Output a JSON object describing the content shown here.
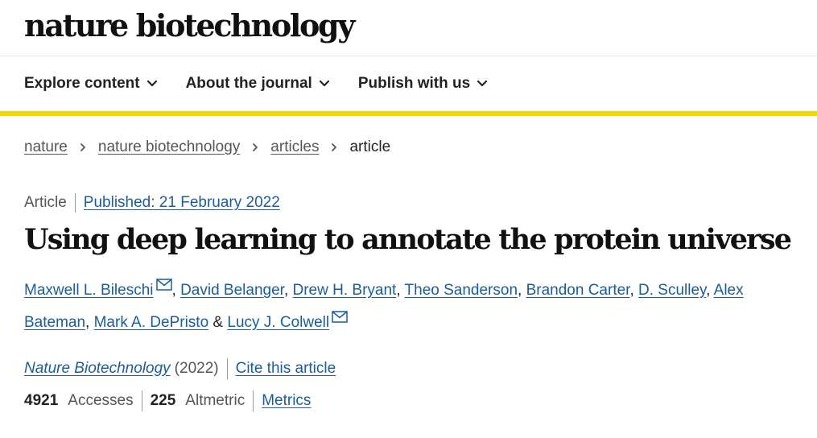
{
  "masthead": {
    "logo_text": "nature biotechnology"
  },
  "nav": {
    "items": [
      {
        "label": "Explore content",
        "icon": "chevron-down-icon"
      },
      {
        "label": "About the journal",
        "icon": "chevron-down-icon"
      },
      {
        "label": "Publish with us",
        "icon": "chevron-down-icon"
      }
    ],
    "accent_color": "#f2d700"
  },
  "breadcrumb": {
    "items": [
      "nature",
      "nature biotechnology",
      "articles"
    ],
    "current": "article",
    "separator_icon": "chevron-right-icon"
  },
  "article": {
    "type": "Article",
    "published": "Published: 21 February 2022",
    "title": "Using deep learning to annotate the protein universe",
    "authors": [
      {
        "name": "Maxwell L. Bileschi",
        "sep": "",
        "email_icon": "mail-icon"
      },
      {
        "name": "David Belanger",
        "sep": ", "
      },
      {
        "name": "Drew H. Bryant",
        "sep": ", "
      },
      {
        "name": "Theo Sanderson",
        "sep": ", "
      },
      {
        "name": "Brandon Carter",
        "sep": ", "
      },
      {
        "name": "D. Sculley",
        "sep": ", "
      },
      {
        "name": "Alex Bateman",
        "sep": ", "
      },
      {
        "name": "Mark A. DePristo",
        "sep": ", "
      },
      {
        "name": "Lucy J. Colwell",
        "sep": " & ",
        "email_icon": "mail-icon"
      }
    ],
    "journal": "Nature Biotechnology",
    "year": "(2022)",
    "cite_label": "Cite this article",
    "accesses": {
      "value": "4921",
      "label": "Accesses"
    },
    "altmetric": {
      "value": "225",
      "label": "Altmetric"
    },
    "metrics_label": "Metrics",
    "link_color": "#1a5d99"
  }
}
